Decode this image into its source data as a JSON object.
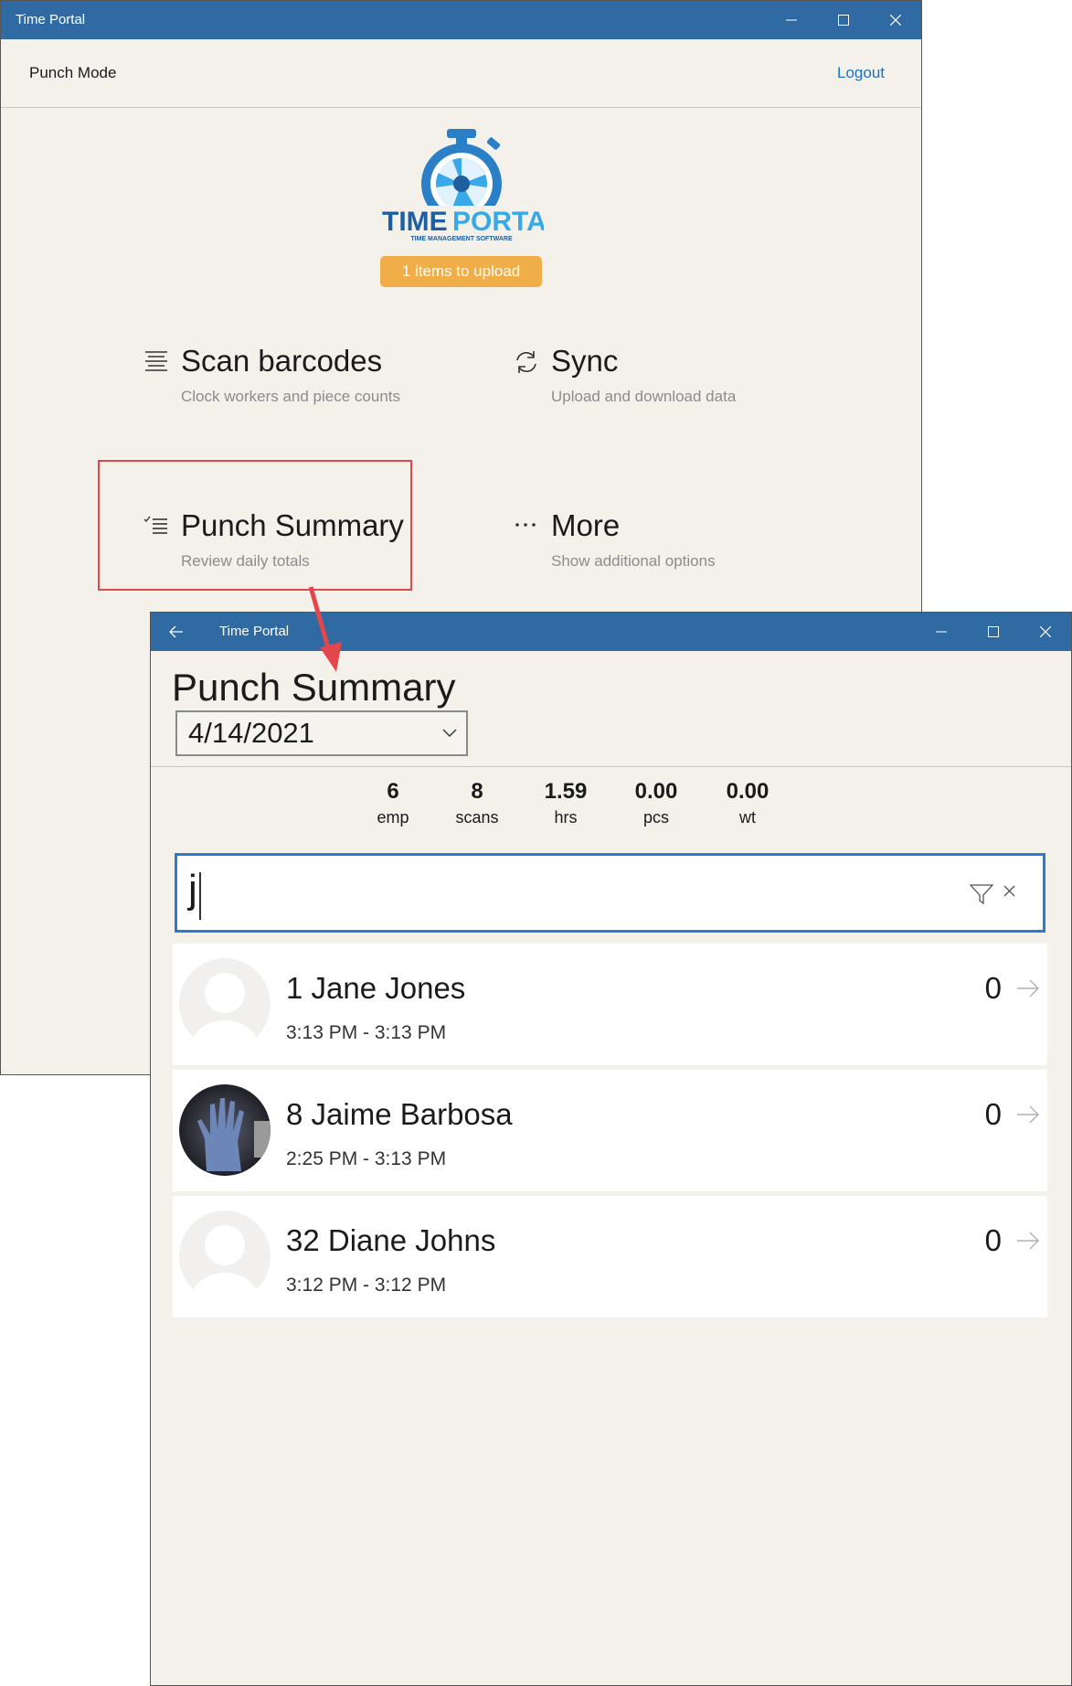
{
  "main_window": {
    "title": "Time Portal",
    "mode_label": "Punch Mode",
    "logout_label": "Logout",
    "logo": {
      "brand_time": "TIME",
      "brand_portal": "PORTAL",
      "tagline": "TIME MANAGEMENT SOFTWARE"
    },
    "upload_badge": "1 items to upload",
    "tiles": [
      {
        "label": "Scan barcodes",
        "sub": "Clock workers and piece counts",
        "icon": "barcode-icon"
      },
      {
        "label": "Sync",
        "sub": "Upload and download data",
        "icon": "sync-icon"
      },
      {
        "label": "Punch Summary",
        "sub": "Review daily totals",
        "icon": "checklist-icon"
      },
      {
        "label": "More",
        "sub": "Show additional options",
        "icon": "more-icon"
      }
    ]
  },
  "summary_window": {
    "title": "Time Portal",
    "page_title": "Punch Summary",
    "date": "4/14/2021",
    "stats": [
      {
        "value": "6",
        "label": "emp"
      },
      {
        "value": "8",
        "label": "scans"
      },
      {
        "value": "1.59",
        "label": "hrs"
      },
      {
        "value": "0.00",
        "label": "pcs"
      },
      {
        "value": "0.00",
        "label": "wt"
      }
    ],
    "search_value": "j",
    "employees": [
      {
        "name": "1  Jane Jones",
        "time": "3:13 PM - 3:13 PM",
        "count": "0",
        "avatar": "placeholder"
      },
      {
        "name": "8  Jaime Barbosa",
        "time": "2:25 PM - 3:13 PM",
        "count": "0",
        "avatar": "photo"
      },
      {
        "name": "32  Diane Johns",
        "time": "3:12 PM - 3:12 PM",
        "count": "0",
        "avatar": "placeholder"
      }
    ]
  },
  "colors": {
    "titlebar": "#2f6aa3",
    "accent": "#1a73c9",
    "badge": "#f0ae48",
    "highlight": "#e4474b"
  }
}
